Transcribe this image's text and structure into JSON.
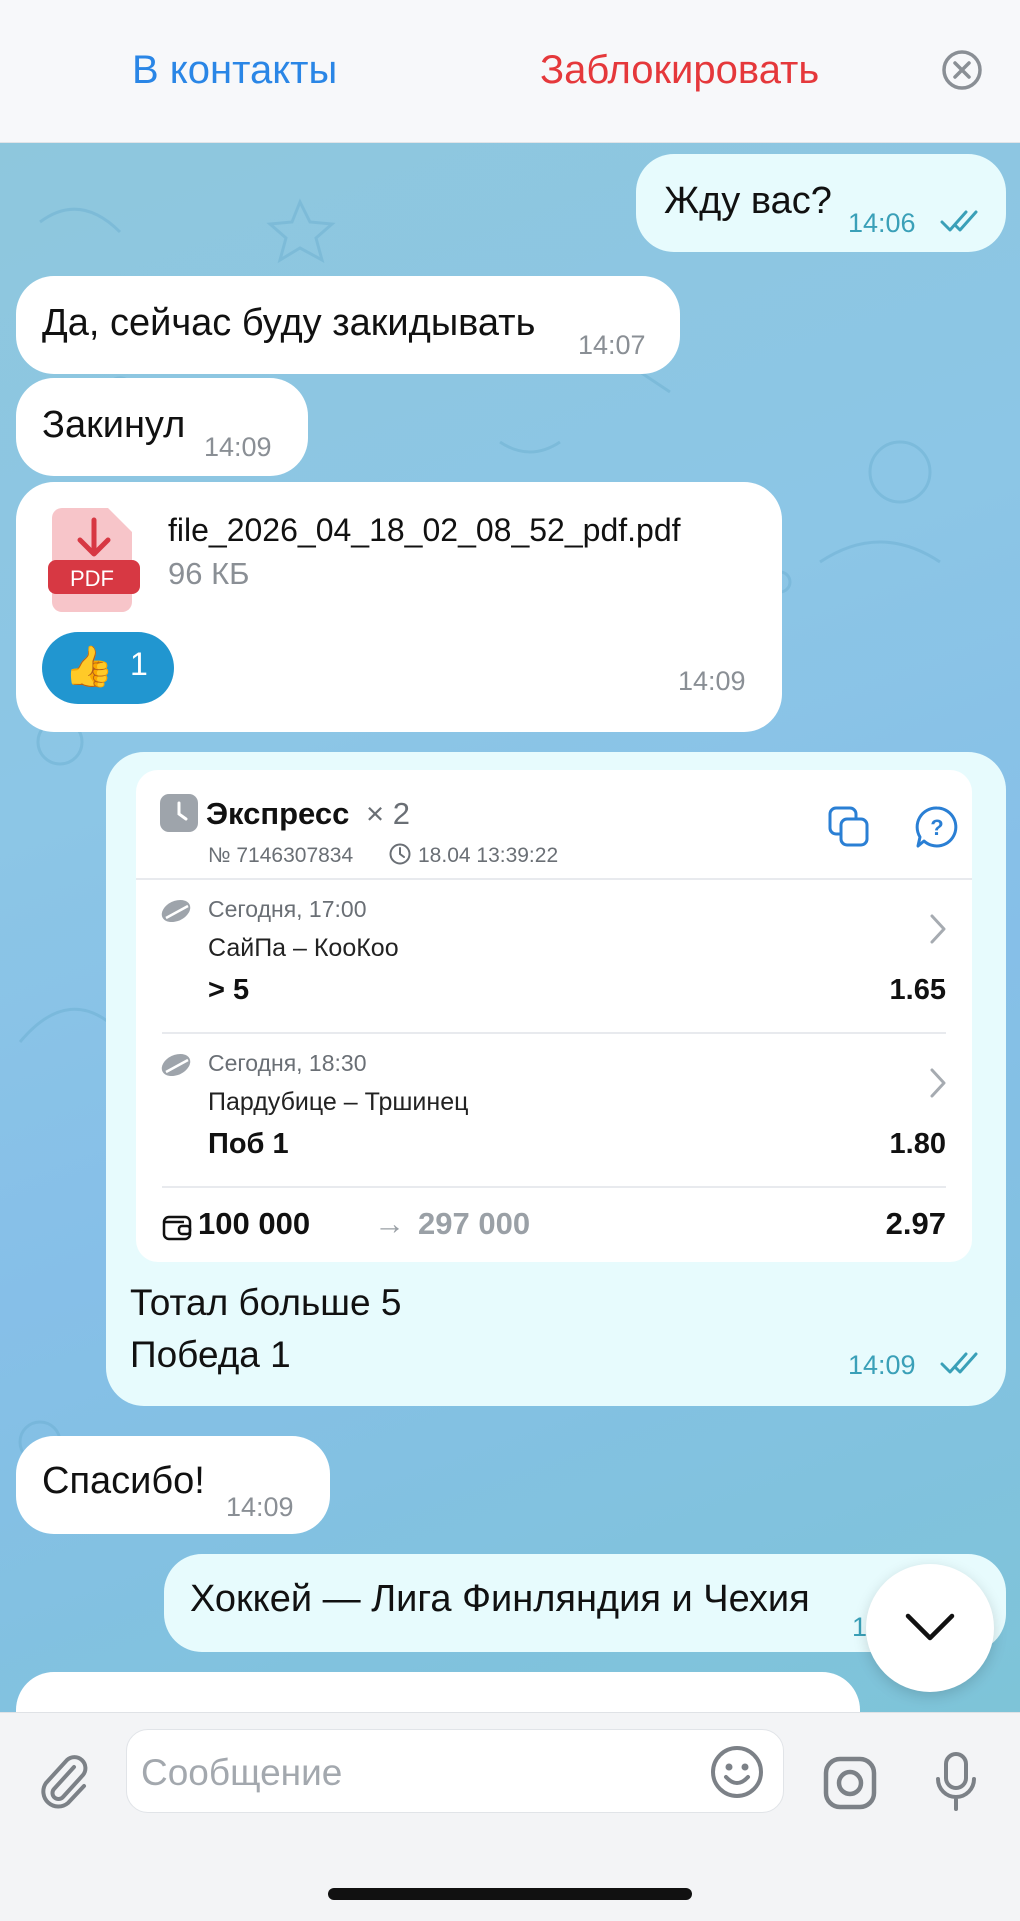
{
  "header": {
    "add_contact_label": "В контакты",
    "block_label": "Заблокировать",
    "close_icon": "close-circle-icon",
    "accent_color": "#2a86e6",
    "danger_color": "#e5383b"
  },
  "messages": [
    {
      "dir": "out",
      "text": "Жду вас?",
      "time": "14:06",
      "status": "read"
    },
    {
      "dir": "in",
      "text": "Да, сейчас буду закидывать",
      "time": "14:07"
    },
    {
      "dir": "in",
      "text": "Закинул",
      "time": "14:09"
    },
    {
      "dir": "in",
      "type": "file",
      "file_icon_label": "PDF",
      "file_name": "file_2026_04_18_02_08_52_pdf.pdf",
      "file_size": "96 КБ",
      "reaction": {
        "emoji": "👍",
        "count": "1"
      },
      "time": "14:09"
    },
    {
      "dir": "out",
      "type": "bet",
      "lines": [
        "Тотал больше 5",
        "Победа 1"
      ],
      "time": "14:09",
      "status": "read"
    },
    {
      "dir": "in",
      "text": "Спасибо!",
      "time": "14:09"
    },
    {
      "dir": "out",
      "text": "Хоккей — Лига Финляндия и Чехия",
      "time": "1"
    }
  ],
  "bet_card": {
    "title": "Экспресс",
    "multiplier": "× 2",
    "number": "№ 7146307834",
    "datetime": "18.04 13:39:22",
    "legs": [
      {
        "when": "Сегодня, 17:00",
        "match": "СайПа – КооКоо",
        "pick": "> 5",
        "odds": "1.65"
      },
      {
        "when": "Сегодня, 18:30",
        "match": "Пардубице – Тршинец",
        "pick": "Поб 1",
        "odds": "1.80"
      }
    ],
    "stake": "100 000",
    "arrow": "→",
    "payout": "297 000",
    "total_odds": "2.97"
  },
  "composer": {
    "placeholder": "Сообщение",
    "attach_icon": "paperclip-icon",
    "emoji_icon": "smiley-icon",
    "camera_icon": "camera-icon",
    "mic_icon": "microphone-icon"
  },
  "colors": {
    "incoming_bubble": "#ffffff",
    "outgoing_bubble": "#e7fbfd",
    "reaction": "#2196d0"
  }
}
